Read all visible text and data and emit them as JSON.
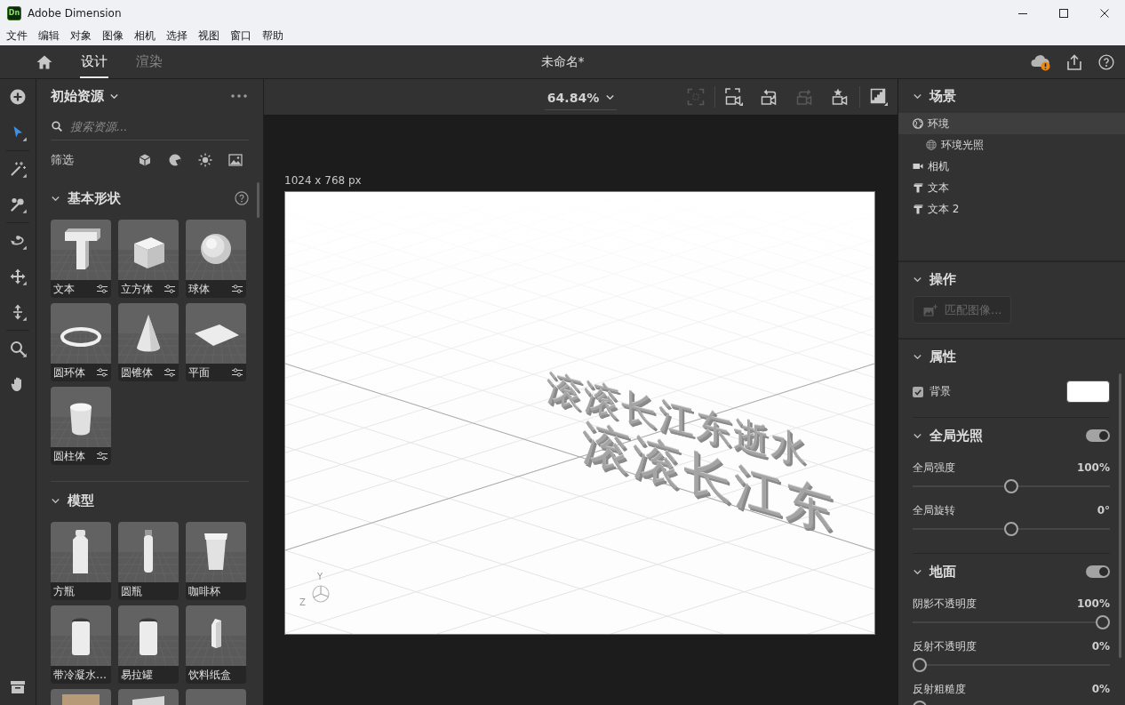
{
  "window": {
    "badge": "Dn",
    "title": "Adobe Dimension"
  },
  "menu": [
    "文件",
    "编辑",
    "对象",
    "图像",
    "相机",
    "选择",
    "视图",
    "窗口",
    "帮助"
  ],
  "header": {
    "tabs": [
      {
        "label": "设计",
        "selected": true
      },
      {
        "label": "渲染",
        "selected": false
      }
    ],
    "document_title": "未命名*"
  },
  "tools": [
    {
      "selected": false
    },
    {
      "selected": true
    },
    {
      "selected": false
    },
    {
      "selected": false
    },
    {
      "selected": false
    },
    {
      "selected": false
    },
    {
      "selected": false
    },
    {
      "selected": false
    },
    {
      "selected": false
    }
  ],
  "assets": {
    "title": "初始资源",
    "search": {
      "placeholder": "搜索资源..."
    },
    "filter_label": "筛选",
    "sections": [
      {
        "title": "基本形状",
        "expanded": true,
        "help": true,
        "items": [
          {
            "label": "文本",
            "kind": "letter",
            "adjustable": true
          },
          {
            "label": "立方体",
            "kind": "cube",
            "adjustable": true
          },
          {
            "label": "球体",
            "kind": "sphere",
            "adjustable": true
          },
          {
            "label": "圆环体",
            "kind": "torus",
            "adjustable": true
          },
          {
            "label": "圆锥体",
            "kind": "cone",
            "adjustable": true
          },
          {
            "label": "平面",
            "kind": "plane",
            "adjustable": true
          },
          {
            "label": "圆柱体",
            "kind": "cylinder",
            "adjustable": true
          }
        ]
      },
      {
        "title": "模型",
        "expanded": true,
        "items": [
          {
            "label": "方瓶",
            "kind": "flask"
          },
          {
            "label": "圆瓶",
            "kind": "bottle"
          },
          {
            "label": "咖啡杯",
            "kind": "cup"
          },
          {
            "label": "带冷凝水…",
            "kind": "can"
          },
          {
            "label": "易拉罐",
            "kind": "can"
          },
          {
            "label": "饮料纸盒",
            "kind": "carton"
          },
          {
            "kind": "bag"
          },
          {
            "kind": "pouch"
          },
          {
            "kind": "blank"
          }
        ]
      }
    ]
  },
  "viewport": {
    "zoom": "64.84%",
    "tools": [
      {
        "disabled": true
      },
      {
        "disabled": false
      },
      {
        "disabled": false
      },
      {
        "disabled": true
      },
      {
        "disabled": false
      },
      {
        "disabled": false
      }
    ],
    "canvas_size": "1024 x 768 px",
    "scene_texts": [
      "滚滚长江东逝水",
      "滚滚长江东"
    ],
    "axis_labels": [
      "Y",
      "Z"
    ]
  },
  "inspector": {
    "scene": {
      "title": "场景",
      "expanded": true,
      "items": [
        {
          "label": "环境",
          "kind": "environment",
          "selected": true,
          "children": [
            {
              "label": "环境光照",
              "kind": "light",
              "selected": false
            }
          ]
        },
        {
          "label": "相机",
          "kind": "camera",
          "selected": false
        },
        {
          "label": "文本",
          "kind": "text",
          "selected": false
        },
        {
          "label": "文本 2",
          "kind": "text",
          "selected": false
        }
      ]
    },
    "actions": {
      "title": "操作",
      "expanded": true,
      "buttons": [
        {
          "label": "匹配图像...",
          "disabled": true
        }
      ]
    },
    "properties": {
      "title": "属性",
      "expanded": true,
      "background": {
        "label": "背景",
        "checked": true,
        "color": "#ffffff"
      },
      "groups": [
        {
          "title": "全局光照",
          "expanded": true,
          "enabled": true,
          "sliders": [
            {
              "label": "全局强度",
              "reading": "100%",
              "level": 0.5
            },
            {
              "label": "全局旋转",
              "reading": "0°",
              "level": 0.5
            }
          ]
        },
        {
          "title": "地面",
          "expanded": true,
          "enabled": true,
          "sliders": [
            {
              "label": "阴影不透明度",
              "reading": "100%",
              "level": 1
            },
            {
              "label": "反射不透明度",
              "reading": "0%",
              "level": 0
            },
            {
              "label": "反射粗糙度",
              "reading": "0%",
              "level": 0
            }
          ]
        }
      ]
    }
  }
}
